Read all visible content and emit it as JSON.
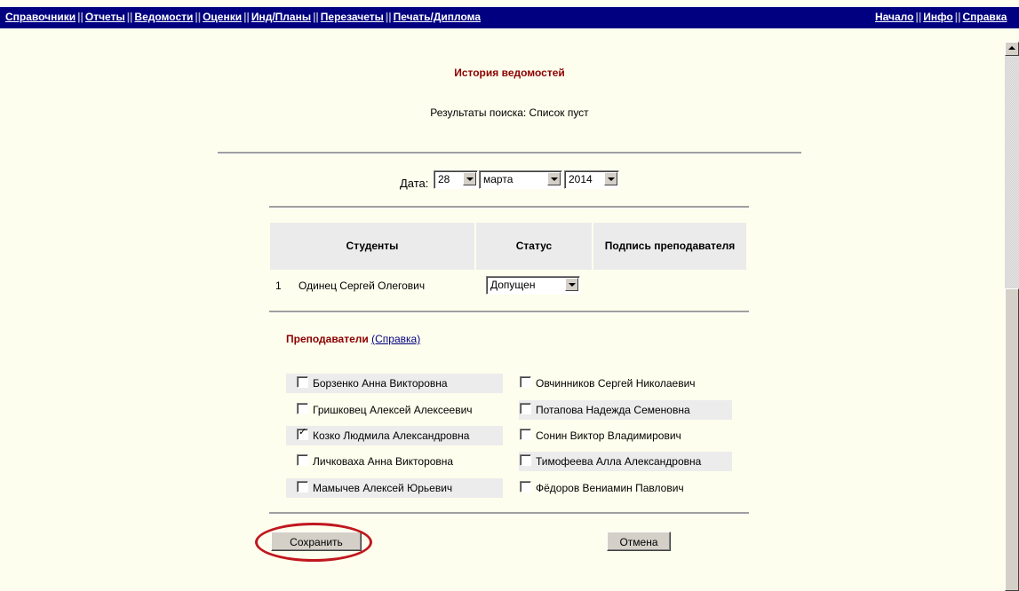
{
  "nav": {
    "left": [
      "Справочники",
      "Отчеты",
      "Ведомости",
      "Оценки",
      "Инд/Планы",
      "Перезачеты",
      "Печать/Диплома"
    ],
    "right": [
      "Начало",
      "Инфо",
      "Справка"
    ]
  },
  "page": {
    "title": "История ведомостей",
    "result": "Результаты поиска: Список пуст"
  },
  "date": {
    "label": "Дата:",
    "day": "28",
    "month": "марта",
    "year": "2014"
  },
  "table": {
    "headers": [
      "Студенты",
      "Статус",
      "Подпись преподавателя"
    ],
    "rows": [
      {
        "num": "1",
        "name": "Одинец Сергей Олегович",
        "status": "Допущен"
      }
    ]
  },
  "teachers": {
    "title": "Преподаватели",
    "help_link": "(Справка)",
    "left": [
      {
        "name": "Борзенко Анна Викторовна",
        "checked": false
      },
      {
        "name": "Гришковец Алексей Алексеевич",
        "checked": false
      },
      {
        "name": "Козко Людмила Александровна",
        "checked": true
      },
      {
        "name": "Личковаха Анна Викторовна",
        "checked": false
      },
      {
        "name": "Мамычев Алексей Юрьевич",
        "checked": false
      }
    ],
    "right": [
      {
        "name": "Овчинников Сергей Николаевич",
        "checked": false
      },
      {
        "name": "Потапова Надежда Семеновна",
        "checked": false
      },
      {
        "name": "Сонин Виктор Владимирович",
        "checked": false
      },
      {
        "name": "Тимофеева Алла Александровна",
        "checked": false
      },
      {
        "name": "Фёдоров Вениамин Павлович",
        "checked": false
      }
    ]
  },
  "buttons": {
    "save": "Сохранить",
    "cancel": "Отмена"
  },
  "colors": {
    "topbar": "#000080",
    "title": "#8b0000",
    "highlight": "#c0171e",
    "background": "#fefeee"
  }
}
